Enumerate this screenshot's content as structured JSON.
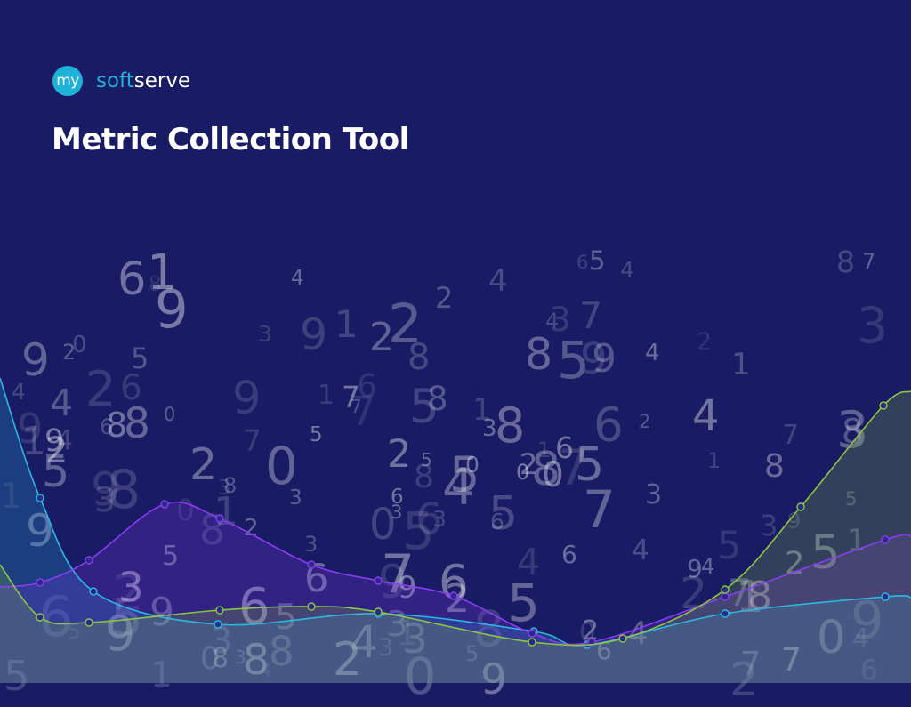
{
  "logo": {
    "badge_text": "my",
    "soft_text": "soft",
    "serve_text": "serve"
  },
  "title": "Metric Collection Tool",
  "background_digits": [
    "3",
    "6",
    "2",
    "7",
    "9",
    "9",
    "8",
    "0",
    "1",
    "3",
    "5",
    "3",
    "8",
    "6",
    "5",
    "8",
    "3",
    "9",
    "6",
    "0",
    "4",
    "2",
    "3",
    "0",
    "3",
    "5",
    "9",
    "2",
    "8",
    "8",
    "2",
    "4",
    "2",
    "3",
    "5",
    "9",
    "4",
    "5",
    "0",
    "2",
    "0",
    "7",
    "0",
    "6",
    "9",
    "2",
    "5",
    "4",
    "2",
    "9",
    "0",
    "5",
    "5",
    "8",
    "1",
    "9",
    "8",
    "4",
    "5",
    "6",
    "2",
    "1",
    "3",
    "7",
    "1",
    "3",
    "7",
    "5",
    "2",
    "1",
    "6",
    "7",
    "1",
    "2",
    "1",
    "7",
    "9",
    "5",
    "8",
    "1",
    "4",
    "1",
    "4",
    "7",
    "1",
    "8",
    "9",
    "6",
    "8",
    "4",
    "4",
    "5",
    "0",
    "6",
    "5",
    "2",
    "5",
    "0",
    "3",
    "9",
    "9",
    "7",
    "2",
    "3",
    "9",
    "9",
    "0",
    "8",
    "9",
    "3",
    "1",
    "5",
    "8",
    "7",
    "6",
    "6",
    "4",
    "8",
    "8",
    "9",
    "3",
    "4",
    "2",
    "4",
    "6",
    "7",
    "8",
    "2",
    "6",
    "8",
    "1",
    "6",
    "8",
    "1",
    "5",
    "9",
    "2",
    "3",
    "7",
    "5",
    "3",
    "6",
    "4",
    "5",
    "4",
    "7",
    "6",
    "4",
    "2",
    "9",
    "6",
    "4",
    "5",
    "8",
    "5",
    "3",
    "7",
    "0",
    "0",
    "3",
    "2",
    "3",
    "5",
    "4",
    "8",
    "6",
    "1",
    "3",
    "8",
    "2"
  ],
  "colors": {
    "background": "#191b64",
    "accent": "#1fb2d8",
    "series_cyan": "#2bb8e0",
    "series_purple": "#8a3cf0",
    "series_green": "#8cc63f",
    "series_blue": "#4a88d8"
  },
  "chart_data": {
    "type": "area",
    "series": [
      {
        "color": "#2bb8e0",
        "values": [
          [
            0,
            425
          ],
          [
            45,
            560
          ],
          [
            105,
            665
          ],
          [
            245,
            702
          ],
          [
            425,
            690
          ],
          [
            600,
            710
          ],
          [
            660,
            725
          ],
          [
            815,
            690
          ],
          [
            995,
            671
          ],
          [
            1024,
            672
          ]
        ]
      },
      {
        "color": "#8a3cf0",
        "values": [
          [
            0,
            660
          ],
          [
            45,
            655
          ],
          [
            100,
            630
          ],
          [
            185,
            567
          ],
          [
            247,
            583
          ],
          [
            350,
            635
          ],
          [
            425,
            653
          ],
          [
            510,
            670
          ],
          [
            598,
            712
          ],
          [
            665,
            722
          ],
          [
            815,
            671
          ],
          [
            995,
            607
          ],
          [
            1024,
            603
          ]
        ]
      },
      {
        "color": "#8cc63f",
        "values": [
          [
            0,
            635
          ],
          [
            45,
            694
          ],
          [
            100,
            700
          ],
          [
            247,
            686
          ],
          [
            350,
            682
          ],
          [
            425,
            688
          ],
          [
            598,
            722
          ],
          [
            700,
            718
          ],
          [
            815,
            663
          ],
          [
            900,
            570
          ],
          [
            993,
            456
          ],
          [
            1024,
            440
          ]
        ]
      }
    ]
  }
}
